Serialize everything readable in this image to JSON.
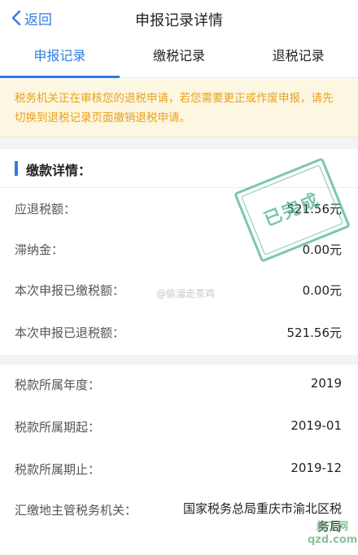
{
  "nav": {
    "back_label": "返回",
    "title": "申报记录详情"
  },
  "tabs": [
    {
      "label": "申报记录",
      "active": true
    },
    {
      "label": "缴税记录",
      "active": false
    },
    {
      "label": "退税记录",
      "active": false
    }
  ],
  "notice": {
    "text": "税务机关正在审核您的退税申请，若您需要更正或作废申报，请先切换到退税记录页面撤销退税申请。"
  },
  "payment_section": {
    "title": "缴款详情：",
    "rows": [
      {
        "label": "应退税额：",
        "value": "521.56元"
      },
      {
        "label": "滞纳金：",
        "value": "0.00元"
      },
      {
        "label": "本次申报已缴税额：",
        "value": "0.00元"
      },
      {
        "label": "本次申报已退税额：",
        "value": "521.56元"
      }
    ]
  },
  "tax_section": {
    "rows": [
      {
        "label": "税款所属年度：",
        "value": "2019"
      },
      {
        "label": "税款所属期起：",
        "value": "2019-01"
      },
      {
        "label": "税款所属期止：",
        "value": "2019-12"
      },
      {
        "label": "汇缴地主管税务机关：",
        "value": "国家税务总局重庆市渝北区税务局"
      }
    ]
  },
  "stamp": {
    "text": "已完成",
    "color": "#5cb89c"
  },
  "watermark": {
    "text": "@偷溜走茶鸡"
  },
  "corner_mark": {
    "line1": "趣丁网",
    "line2": "qzd.com"
  },
  "colors": {
    "accent": "#2f7de1",
    "notice_text": "#e9a21a",
    "notice_bg": "#fdf6e1"
  }
}
